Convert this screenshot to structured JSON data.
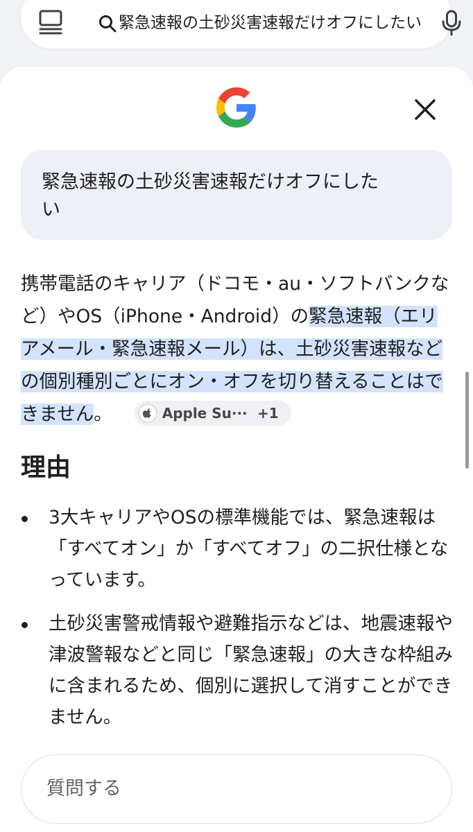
{
  "search_bar": {
    "query": "緊急速報の土砂災害速報だけオフにしたい",
    "history_icon": "history-list-icon",
    "search_icon": "search-icon",
    "mic_icon": "mic-icon"
  },
  "panel": {
    "logo_icon": "google-g-logo",
    "close_icon": "close-icon",
    "query_bubble": {
      "line1": "緊急速報の土砂災害速報だけオフにした",
      "line2": "い"
    },
    "answer": {
      "text_plain": "携帯電話のキャリア（ドコモ・au・ソフトバンクなど）やOS（iPhone・Android）の",
      "text_highlight": "緊急速報（エリアメール・緊急速報メール）は、土砂災害速報などの個別種別ごとにオン・オフを切り替えることはできません",
      "text_end": "。",
      "source_chip": {
        "label": "Apple Su···",
        "count": "+1",
        "icon": "apple-icon"
      }
    },
    "section_heading": "理由",
    "bullets": [
      "3大キャリアやOSの標準機能では、緊急速報は「すべてオン」か「すべてオフ」の二択仕様となっています。",
      "土砂災害警戒情報や避難指示などは、地震速報や津波警報などと同じ「緊急速報」の大きな枠組みに含まれるため、個別に選択して消すことができません。"
    ],
    "ask_input_placeholder": "質問する"
  },
  "colors": {
    "highlight": "#d3e3fd",
    "bubble": "#eef0f7",
    "text": "#1f1f1f"
  }
}
